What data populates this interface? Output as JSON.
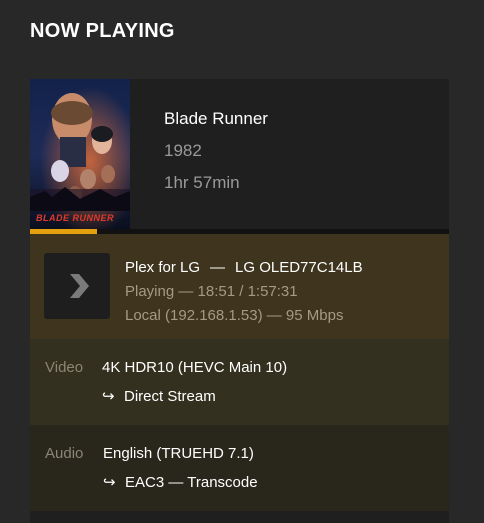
{
  "section": {
    "title": "NOW PLAYING"
  },
  "media": {
    "poster_title": "BLADE RUNNER",
    "title": "Blade Runner",
    "year": "1982",
    "duration": "1hr 57min",
    "progress_fraction": 0.16
  },
  "player": {
    "app": "Plex for LG",
    "separator": "—",
    "device": "LG OLED77C14LB",
    "status": "Playing — 18:51 / 1:57:31",
    "network": "Local (192.168.1.53) — 95 Mbps",
    "icon": "chevron-right-icon"
  },
  "video": {
    "label": "Video",
    "value": "4K HDR10 (HEVC Main 10)",
    "decision": "Direct Stream",
    "arrow": "↪"
  },
  "audio": {
    "label": "Audio",
    "value": "English (TRUEHD 7.1)",
    "decision": "EAC3 — Transcode",
    "arrow": "↪"
  },
  "colors": {
    "background": "#282828",
    "card": "#1f1f1f",
    "accent": "#e5a00d",
    "player_band": "#3f351e",
    "video_band": "#33301f",
    "audio_band": "#29261b"
  }
}
